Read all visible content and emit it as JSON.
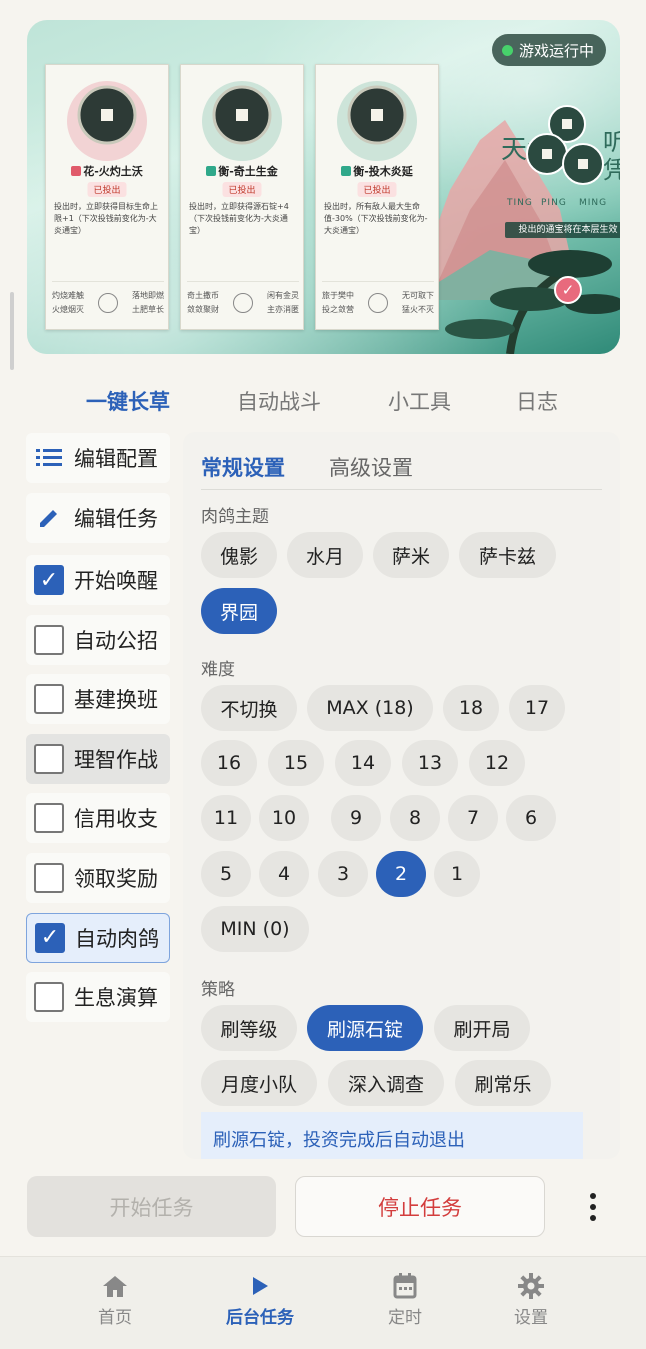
{
  "banner": {
    "status": "游戏运行中",
    "cards": [
      {
        "title": "花-火灼土沃",
        "status": "已投出",
        "desc": "投出时，立即获得目标生命上限+1（下次投钱前变化为-大炎通宝）",
        "foot_left": [
          "灼烧难触",
          "火熄烟灭"
        ],
        "foot_right": [
          "落地即燃",
          "土肥草长"
        ],
        "type_color": "#e05a6a"
      },
      {
        "title": "衡-奇土生金",
        "status": "已投出",
        "desc": "投出时，立即获得源石锭+4（下次投钱前变化为-大炎通宝）",
        "foot_left": [
          "奇土撒币",
          "敛敛聚财"
        ],
        "foot_right": [
          "闲有金灵",
          "主亦消匿"
        ],
        "type_color": "#2fa88a"
      },
      {
        "title": "衡-投木炎延",
        "status": "已投出",
        "desc": "投出时，所有敌人最大生命值-30%（下次投钱前变化为-大炎通宝）",
        "foot_left": [
          "旅于樊中",
          "投之敛营"
        ],
        "foot_right": [
          "无可取下",
          "猛火不灭"
        ],
        "type_color": "#2fa88a"
      }
    ],
    "title_left": "天命",
    "title_right": "听凭",
    "pinyin": [
      "TING",
      "PING",
      "MING"
    ],
    "coin_note": "投出的通宝将在本层生效"
  },
  "tabs": [
    "一键长草",
    "自动战斗",
    "小工具",
    "日志"
  ],
  "active_tab": 0,
  "left_menu": {
    "edit_config": "编辑配置",
    "edit_task": "编辑任务",
    "items": [
      {
        "label": "开始唤醒",
        "checked": true
      },
      {
        "label": "自动公招",
        "checked": false
      },
      {
        "label": "基建换班",
        "checked": false
      },
      {
        "label": "理智作战",
        "checked": false
      },
      {
        "label": "信用收支",
        "checked": false
      },
      {
        "label": "领取奖励",
        "checked": false
      },
      {
        "label": "自动肉鸽",
        "checked": true
      },
      {
        "label": "生息演算",
        "checked": false
      }
    ]
  },
  "panel": {
    "sub_tabs": [
      "常规设置",
      "高级设置"
    ],
    "theme_label": "肉鸽主题",
    "themes": [
      "傀影",
      "水月",
      "萨米",
      "萨卡兹",
      "界园"
    ],
    "theme_selected": "界园",
    "difficulty_label": "难度",
    "difficulties": [
      "不切换",
      "MAX (18)",
      "18",
      "17",
      "16",
      "15",
      "14",
      "13",
      "12",
      "11",
      "10",
      "9",
      "8",
      "7",
      "6",
      "5",
      "4",
      "3",
      "2",
      "1",
      "MIN (0)"
    ],
    "difficulty_selected": "2",
    "strategy_label": "策略",
    "strategies": [
      "刷等级",
      "刷源石锭",
      "刷开局",
      "月度小队",
      "深入调查",
      "刷常乐"
    ],
    "strategy_selected": "刷源石锭",
    "info": "刷源石锭，投资完成后自动退出"
  },
  "buttons": {
    "start": "开始任务",
    "stop": "停止任务"
  },
  "nav": [
    {
      "label": "首页",
      "icon": "home-icon"
    },
    {
      "label": "后台任务",
      "icon": "play-icon"
    },
    {
      "label": "定时",
      "icon": "calendar-icon"
    },
    {
      "label": "设置",
      "icon": "gear-icon"
    }
  ],
  "nav_active": 1,
  "colors": {
    "accent": "#2c61b8",
    "stop": "#d33d3d",
    "status_dot": "#47d16b"
  }
}
